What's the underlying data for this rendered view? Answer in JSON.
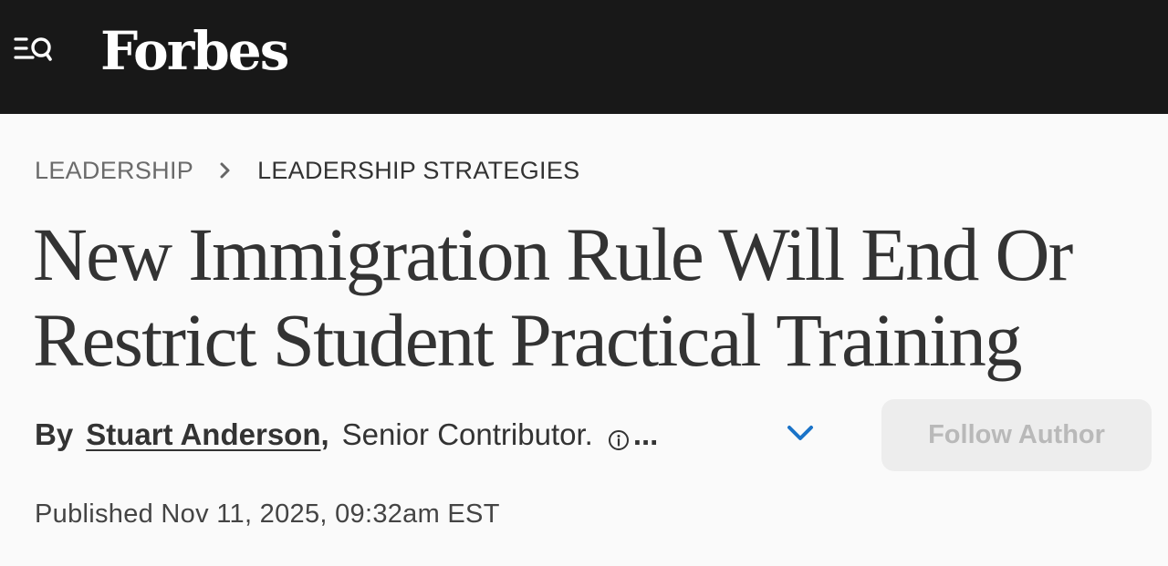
{
  "header": {
    "logo_text": "Forbes",
    "menu_icon": "menu-search-icon",
    "background_color": "#181818"
  },
  "breadcrumb": {
    "items": [
      "LEADERSHIP",
      "LEADERSHIP STRATEGIES"
    ],
    "separator_icon": "chevron-right-icon"
  },
  "article": {
    "title": "New Immigration Rule Will End Or Restrict Student Practical Training",
    "byline": {
      "by_label": "By",
      "author_name": "Stuart Anderson",
      "comma": ",",
      "author_role": "Senior Contributor.",
      "info_icon": "info-icon",
      "ellipsis": "...",
      "expand_icon": "chevron-down-icon",
      "expand_icon_color": "#1a73c8"
    },
    "follow_button_label": "Follow Author",
    "published": "Published Nov 11, 2025, 09:32am EST"
  }
}
